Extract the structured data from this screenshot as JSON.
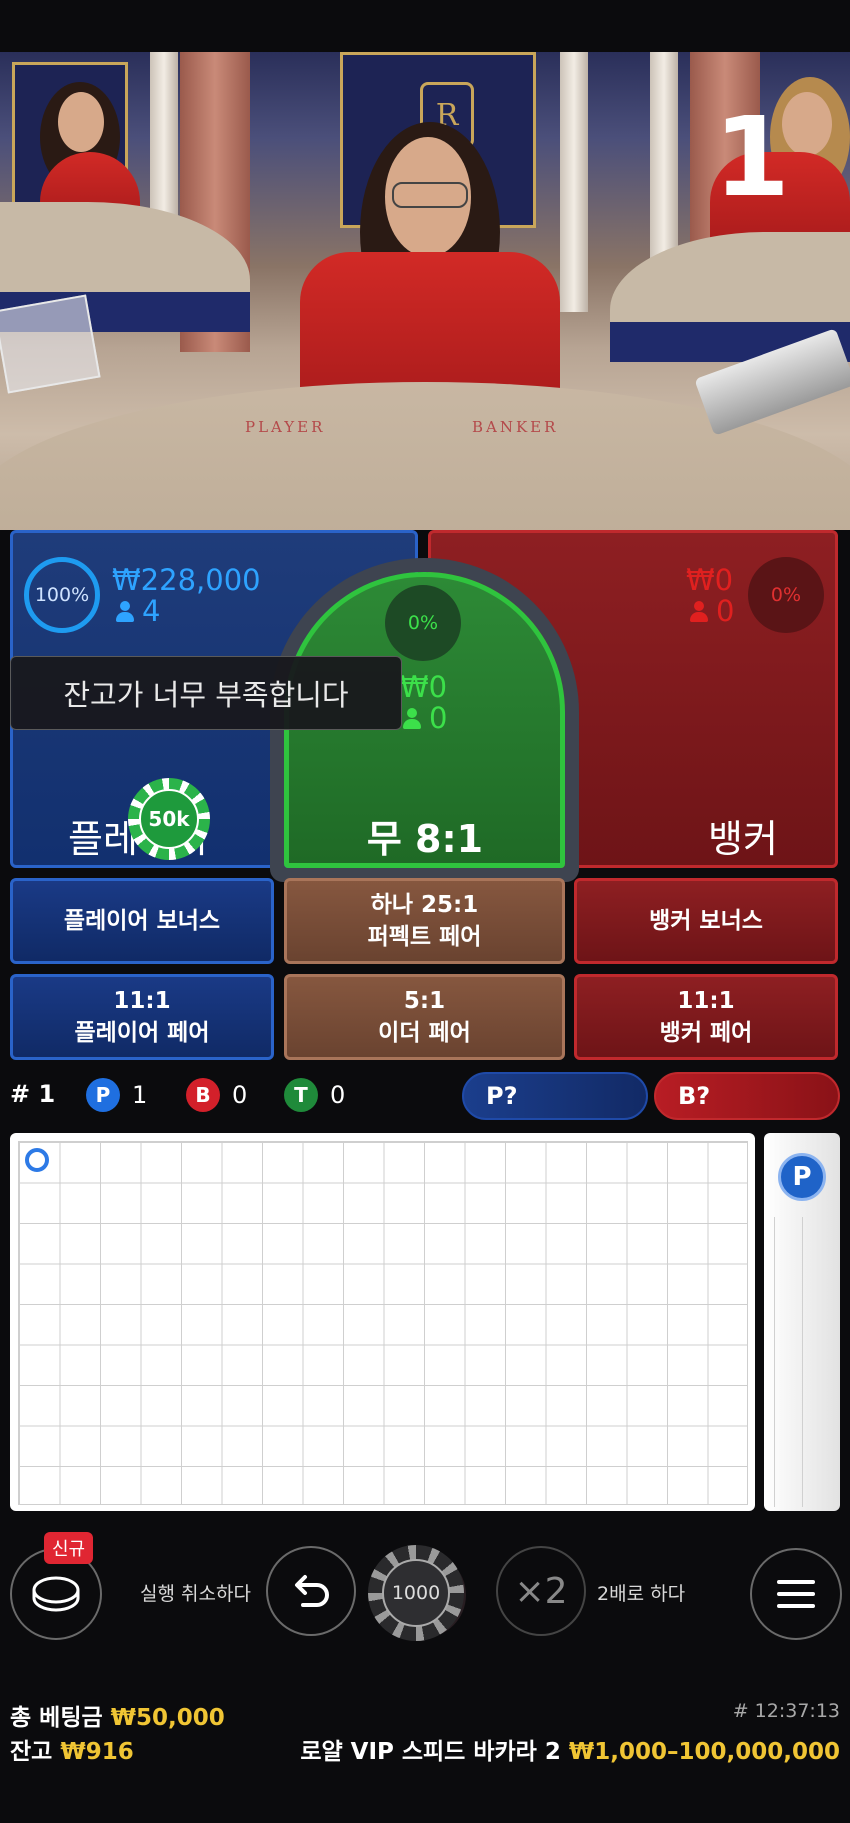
{
  "video": {
    "round_number": "1",
    "felt_player": "PLAYER",
    "felt_banker": "BANKER",
    "logo_letter": "R"
  },
  "player": {
    "percent": "100%",
    "amount": "₩228,000",
    "count": "4",
    "label": "플레이어",
    "chip": "50k"
  },
  "tie": {
    "percent": "0%",
    "amount": "₩0",
    "count": "0",
    "label": "무 8:1"
  },
  "banker": {
    "percent": "0%",
    "amount": "₩0",
    "count": "0",
    "label": "뱅커"
  },
  "toast": "잔고가 너무 부족합니다",
  "side_bets": {
    "player_bonus": "플레이어 보너스",
    "perfect_pair_line1": "하나 25:1",
    "perfect_pair_line2": "퍼펙트 페어",
    "banker_bonus": "뱅커 보너스",
    "player_pair_line1": "11:1",
    "player_pair_line2": "플레이어 페어",
    "either_pair_line1": "5:1",
    "either_pair_line2": "이더 페어",
    "banker_pair_line1": "11:1",
    "banker_pair_line2": "뱅커 페어"
  },
  "stats": {
    "round": "# 1",
    "p_letter": "P",
    "p_count": "1",
    "b_letter": "B",
    "b_count": "0",
    "t_letter": "T",
    "t_count": "0",
    "predict_player": "P?",
    "predict_banker": "B?"
  },
  "roadmap": {
    "side_marker": "P"
  },
  "controls": {
    "new_badge": "신규",
    "undo_label": "실행 취소하다",
    "chip_value": "1000",
    "double_symbol": "×2",
    "double_label": "2배로 하다"
  },
  "footer": {
    "total_bet_label": "총 베팅금",
    "total_bet_value": "₩50,000",
    "balance_label": "잔고",
    "balance_value": "₩916",
    "time": "# 12:37:13",
    "table_name": "로얄 VIP 스피드 바카라 2",
    "limits": "₩1,000–100,000,000"
  },
  "colors": {
    "player_blue": "#2a63c9",
    "banker_red": "#c0292d",
    "tie_green": "#2fc43e",
    "gold": "#f0c534"
  }
}
